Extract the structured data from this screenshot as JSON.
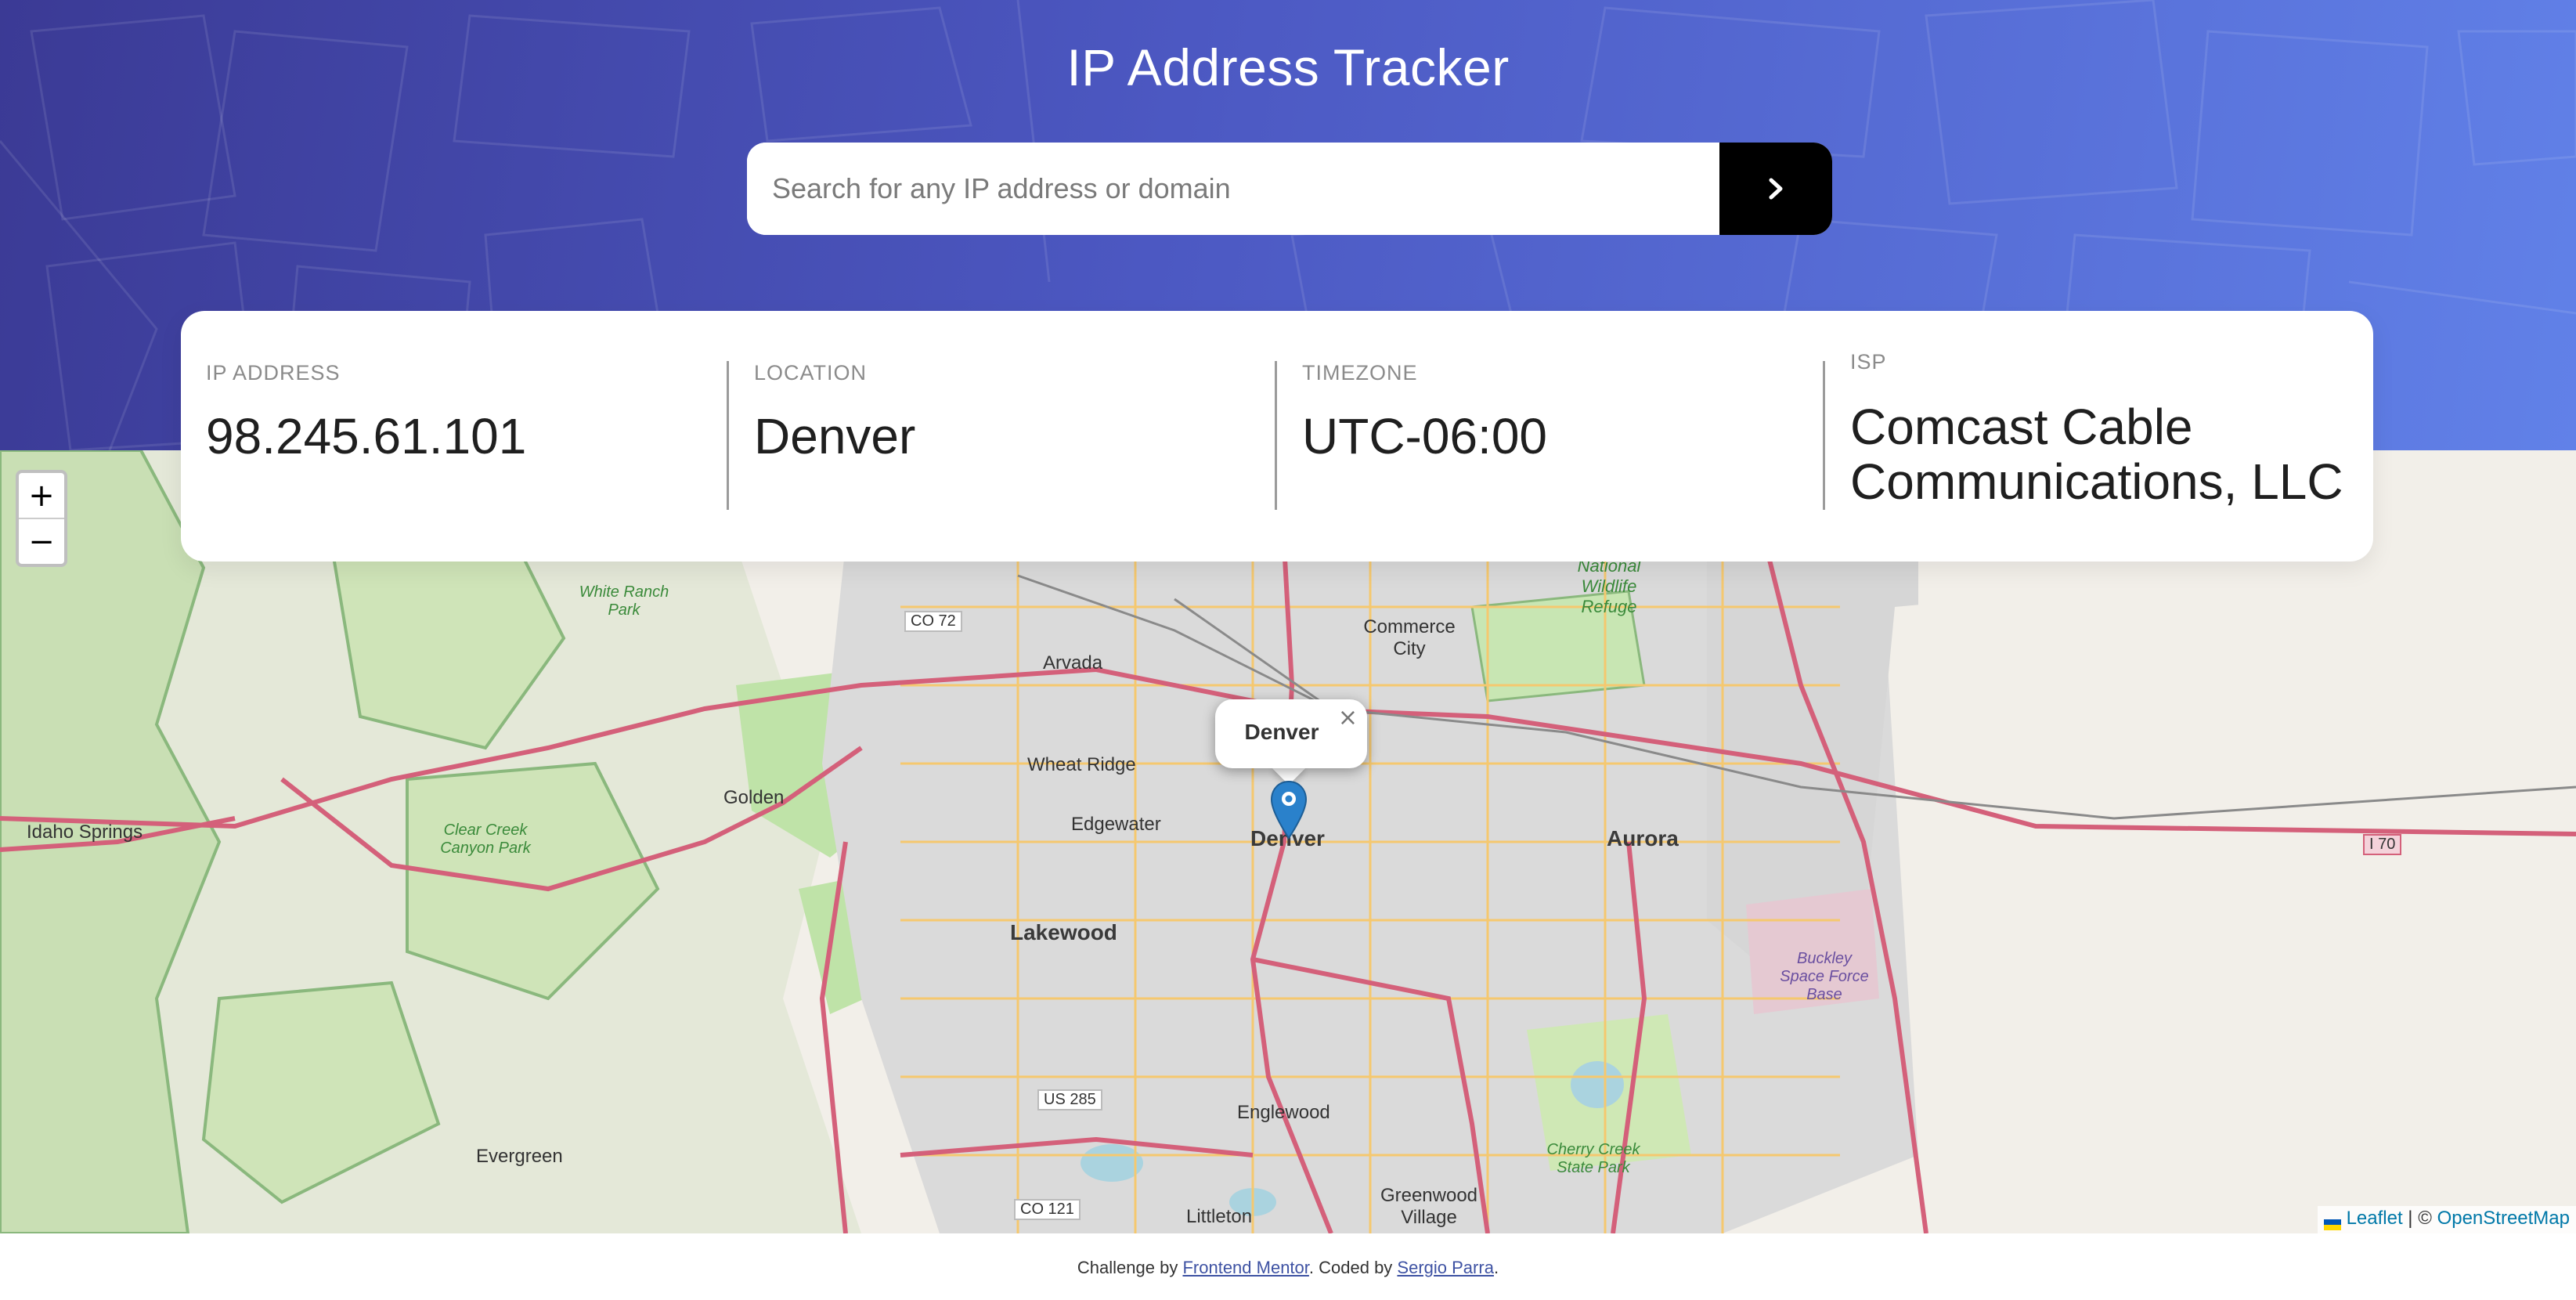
{
  "header": {
    "title": "IP Address Tracker"
  },
  "search": {
    "placeholder": "Search for any IP address or domain",
    "value": "",
    "button_icon": "chevron-right-icon"
  },
  "info": {
    "ip": {
      "label": "IP ADDRESS",
      "value": "98.245.61.101"
    },
    "location": {
      "label": "LOCATION",
      "value": "Denver"
    },
    "timezone": {
      "label": "TIMEZONE",
      "value": "UTC-06:00"
    },
    "isp": {
      "label": "ISP",
      "value_line1": "Comcast Cable",
      "value_line2": "Communications, LLC"
    }
  },
  "map": {
    "zoom_in": "+",
    "zoom_out": "−",
    "popup_text": "Denver",
    "popup_close": "×",
    "marker_icon": "map-pin-icon",
    "labels": {
      "denver": "Denver",
      "aurora": "Aurora",
      "lakewood": "Lakewood",
      "golden": "Golden",
      "arvada": "Arvada",
      "wheat_ridge": "Wheat Ridge",
      "edgewater": "Edgewater",
      "englewood": "Englewood",
      "littleton": "Littleton",
      "greenwood_village": "Greenwood Village",
      "evergreen": "Evergreen",
      "idaho_springs": "Idaho Springs",
      "commerce_city": "Commerce City",
      "buckley": "Buckley Space Force Base",
      "wildlife_refuge": "National Wildlife Refuge",
      "white_ranch": "White Ranch Park",
      "clear_creek": "Clear Creek Canyon Park",
      "cherry_creek": "Cherry Creek State Park",
      "co72": "CO 72",
      "us285": "US 285",
      "co121": "CO 121",
      "i70": "I 70"
    },
    "attribution": {
      "leaflet": "Leaflet",
      "separator": " | © ",
      "osm": "OpenStreetMap"
    }
  },
  "footer": {
    "prefix": "Challenge by ",
    "frontend_mentor": "Frontend Mentor",
    "middle": ". Coded by ",
    "author": "Sergio Parra",
    "suffix": "."
  },
  "colors": {
    "header_start": "#3b3a95",
    "header_end": "#6181e8",
    "button": "#000000",
    "marker": "#2a81cb",
    "road_major": "#d4607a",
    "road_minor": "#f3c26b",
    "park": "#c8e6b3",
    "park_border": "#8ab87d"
  }
}
